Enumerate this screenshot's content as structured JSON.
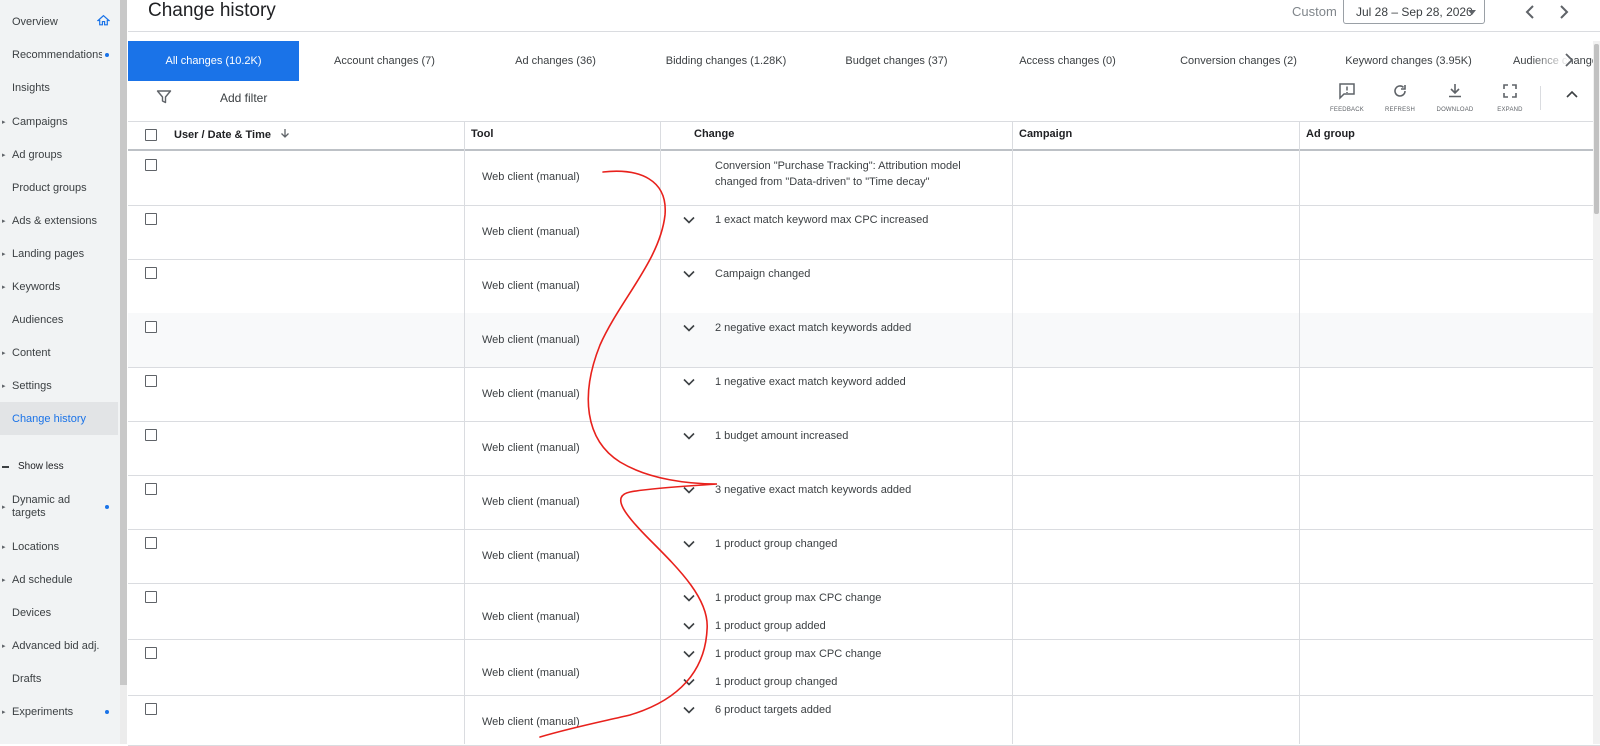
{
  "sidebar": {
    "items": [
      {
        "label": "Overview",
        "expand": false,
        "dot": false,
        "active": false
      },
      {
        "label": "Recommendations",
        "expand": false,
        "dot": true,
        "active": false
      },
      {
        "label": "Insights",
        "expand": false,
        "dot": false,
        "active": false
      },
      {
        "label": "Campaigns",
        "expand": true,
        "dot": false,
        "active": false
      },
      {
        "label": "Ad groups",
        "expand": true,
        "dot": false,
        "active": false
      },
      {
        "label": "Product groups",
        "expand": false,
        "dot": false,
        "active": false
      },
      {
        "label": "Ads & extensions",
        "expand": true,
        "dot": false,
        "active": false
      },
      {
        "label": "Landing pages",
        "expand": true,
        "dot": false,
        "active": false
      },
      {
        "label": "Keywords",
        "expand": true,
        "dot": false,
        "active": false
      },
      {
        "label": "Audiences",
        "expand": false,
        "dot": false,
        "active": false
      },
      {
        "label": "Content",
        "expand": true,
        "dot": false,
        "active": false
      },
      {
        "label": "Settings",
        "expand": true,
        "dot": false,
        "active": false
      },
      {
        "label": "Change history",
        "expand": false,
        "dot": false,
        "active": true
      }
    ],
    "show_less": "Show less",
    "more_items": [
      {
        "label": "Dynamic ad",
        "label2": "targets",
        "expand": true,
        "dot": true
      },
      {
        "label": "Locations",
        "expand": true,
        "dot": false
      },
      {
        "label": "Ad schedule",
        "expand": true,
        "dot": false
      },
      {
        "label": "Devices",
        "expand": false,
        "dot": false
      },
      {
        "label": "Advanced bid adj.",
        "expand": true,
        "dot": false
      },
      {
        "label": "Drafts",
        "expand": false,
        "dot": false
      },
      {
        "label": "Experiments",
        "expand": true,
        "dot": true
      }
    ]
  },
  "header": {
    "title": "Change history",
    "range_label": "Custom",
    "date_range": "Jul 28 – Sep 28, 2020"
  },
  "tabs": [
    {
      "label": "All changes (10.2K)",
      "active": true
    },
    {
      "label": "Account changes (7)",
      "active": false
    },
    {
      "label": "Ad changes (36)",
      "active": false
    },
    {
      "label": "Bidding changes (1.28K)",
      "active": false
    },
    {
      "label": "Budget changes (37)",
      "active": false
    },
    {
      "label": "Access changes (0)",
      "active": false
    },
    {
      "label": "Conversion changes (2)",
      "active": false
    },
    {
      "label": "Keyword changes (3.95K)",
      "active": false
    },
    {
      "label": "Audience changes",
      "active": false
    }
  ],
  "toolbar": {
    "add_filter": "Add filter",
    "feedback": "FEEDBACK",
    "refresh": "REFRESH",
    "download": "DOWNLOAD",
    "expand": "EXPAND"
  },
  "table": {
    "columns": {
      "user": "User / Date & Time",
      "tool": "Tool",
      "change": "Change",
      "campaign": "Campaign",
      "ad_group": "Ad group"
    },
    "rows": [
      {
        "tool": "Web client (manual)",
        "changes": [
          "Conversion \"Purchase Tracking\": Attribution model changed from \"Data-driven\" to \"Time decay\""
        ],
        "expandable": false
      },
      {
        "tool": "Web client (manual)",
        "changes": [
          "1 exact match keyword max CPC increased"
        ],
        "expandable": true
      },
      {
        "tool": "Web client (manual)",
        "changes": [
          "Campaign changed"
        ],
        "expandable": true
      },
      {
        "tool": "Web client (manual)",
        "changes": [
          "2 negative exact match keywords added"
        ],
        "expandable": true
      },
      {
        "tool": "Web client (manual)",
        "changes": [
          "1 negative exact match keyword added"
        ],
        "expandable": true
      },
      {
        "tool": "Web client (manual)",
        "changes": [
          "1 budget amount increased"
        ],
        "expandable": true
      },
      {
        "tool": "Web client (manual)",
        "changes": [
          "3 negative exact match keywords added"
        ],
        "expandable": true
      },
      {
        "tool": "Web client (manual)",
        "changes": [
          "1 product group changed"
        ],
        "expandable": true
      },
      {
        "tool": "Web client (manual)",
        "changes": [
          "1 product group max CPC change",
          "1 product group added"
        ],
        "expandable": true
      },
      {
        "tool": "Web client (manual)",
        "changes": [
          "1 product group max CPC change",
          "1 product group changed"
        ],
        "expandable": true
      },
      {
        "tool": "Web client (manual)",
        "changes": [
          "6 product targets added"
        ],
        "expandable": true
      }
    ]
  },
  "colors": {
    "accent": "#1a73e8",
    "annotation": "#e8211c"
  }
}
